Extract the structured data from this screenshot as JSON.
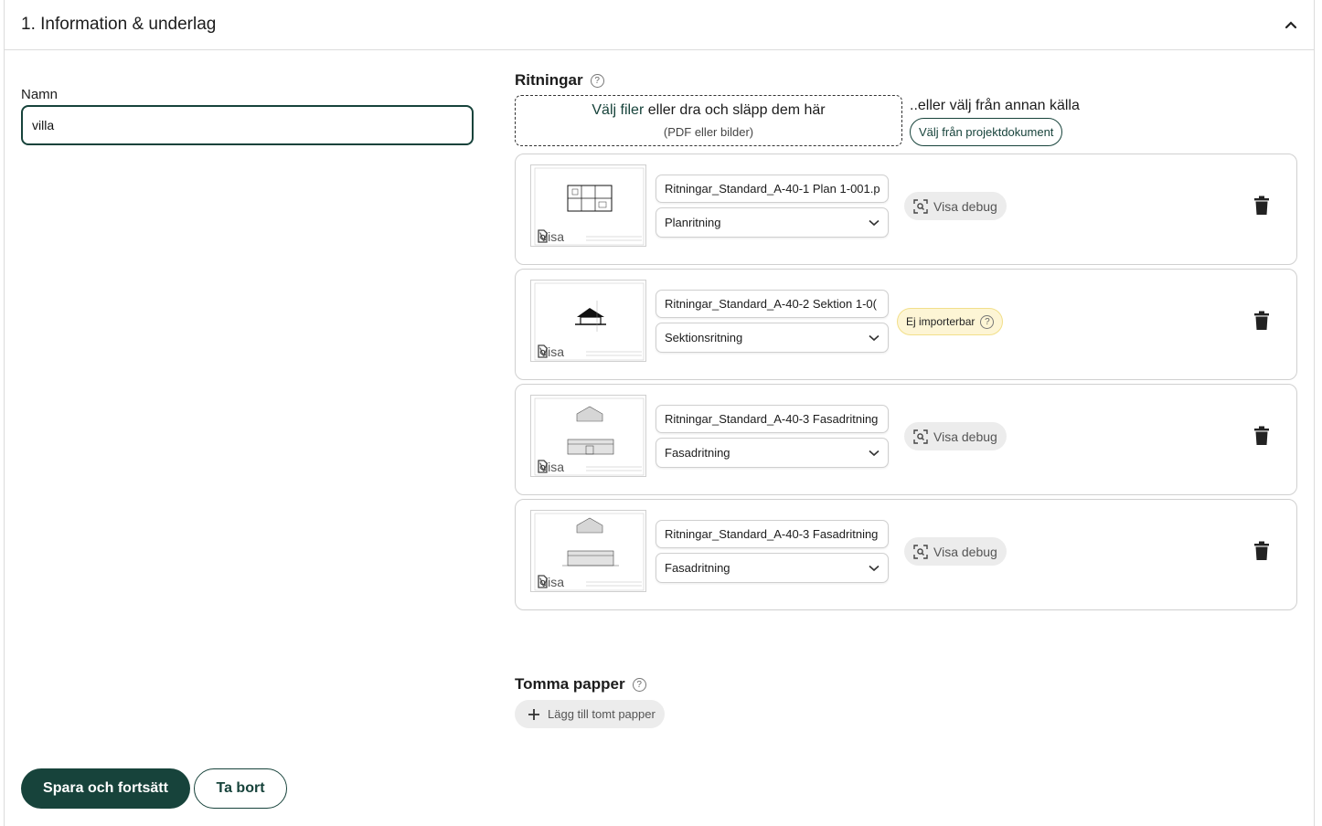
{
  "section": {
    "title": "1. Information & underlag",
    "collapse_icon": "chevron-up-icon"
  },
  "name_field": {
    "label": "Namn",
    "value": "villa"
  },
  "drawings": {
    "label": "Ritningar",
    "help_icon": "question-circle-icon",
    "dropzone": {
      "link_text": "Välj filer",
      "text": "eller dra och släpp dem här",
      "hint": "(PDF eller bilder)"
    },
    "alt_source_text": "..eller välj från annan källa",
    "project_docs_button": "Välj från projektdokument",
    "items": [
      {
        "filename": "Ritningar_Standard_A-40-1 Plan 1-001.p",
        "type": "Planritning",
        "view_label": "Visa",
        "action": "Visa debug",
        "status": "ok"
      },
      {
        "filename": "Ritningar_Standard_A-40-2 Sektion 1-0(",
        "type": "Sektionsritning",
        "view_label": "Visa",
        "action": "Ej importerbar",
        "status": "warning"
      },
      {
        "filename": "Ritningar_Standard_A-40-3 Fasadritning",
        "type": "Fasadritning",
        "view_label": "Visa",
        "action": "Visa debug",
        "status": "ok"
      },
      {
        "filename": "Ritningar_Standard_A-40-3 Fasadritning",
        "type": "Fasadritning",
        "view_label": "Visa",
        "action": "Visa debug",
        "status": "ok"
      }
    ]
  },
  "empty_papers": {
    "label": "Tomma papper",
    "add_button": "Lägg till tomt papper"
  },
  "footer": {
    "save_button": "Spara och fortsätt",
    "delete_button": "Ta bort"
  },
  "colors": {
    "primary": "#17433b",
    "warning_bg": "#fdf5d5",
    "warning_border": "#f2df8a",
    "chip_bg": "#ececec"
  }
}
